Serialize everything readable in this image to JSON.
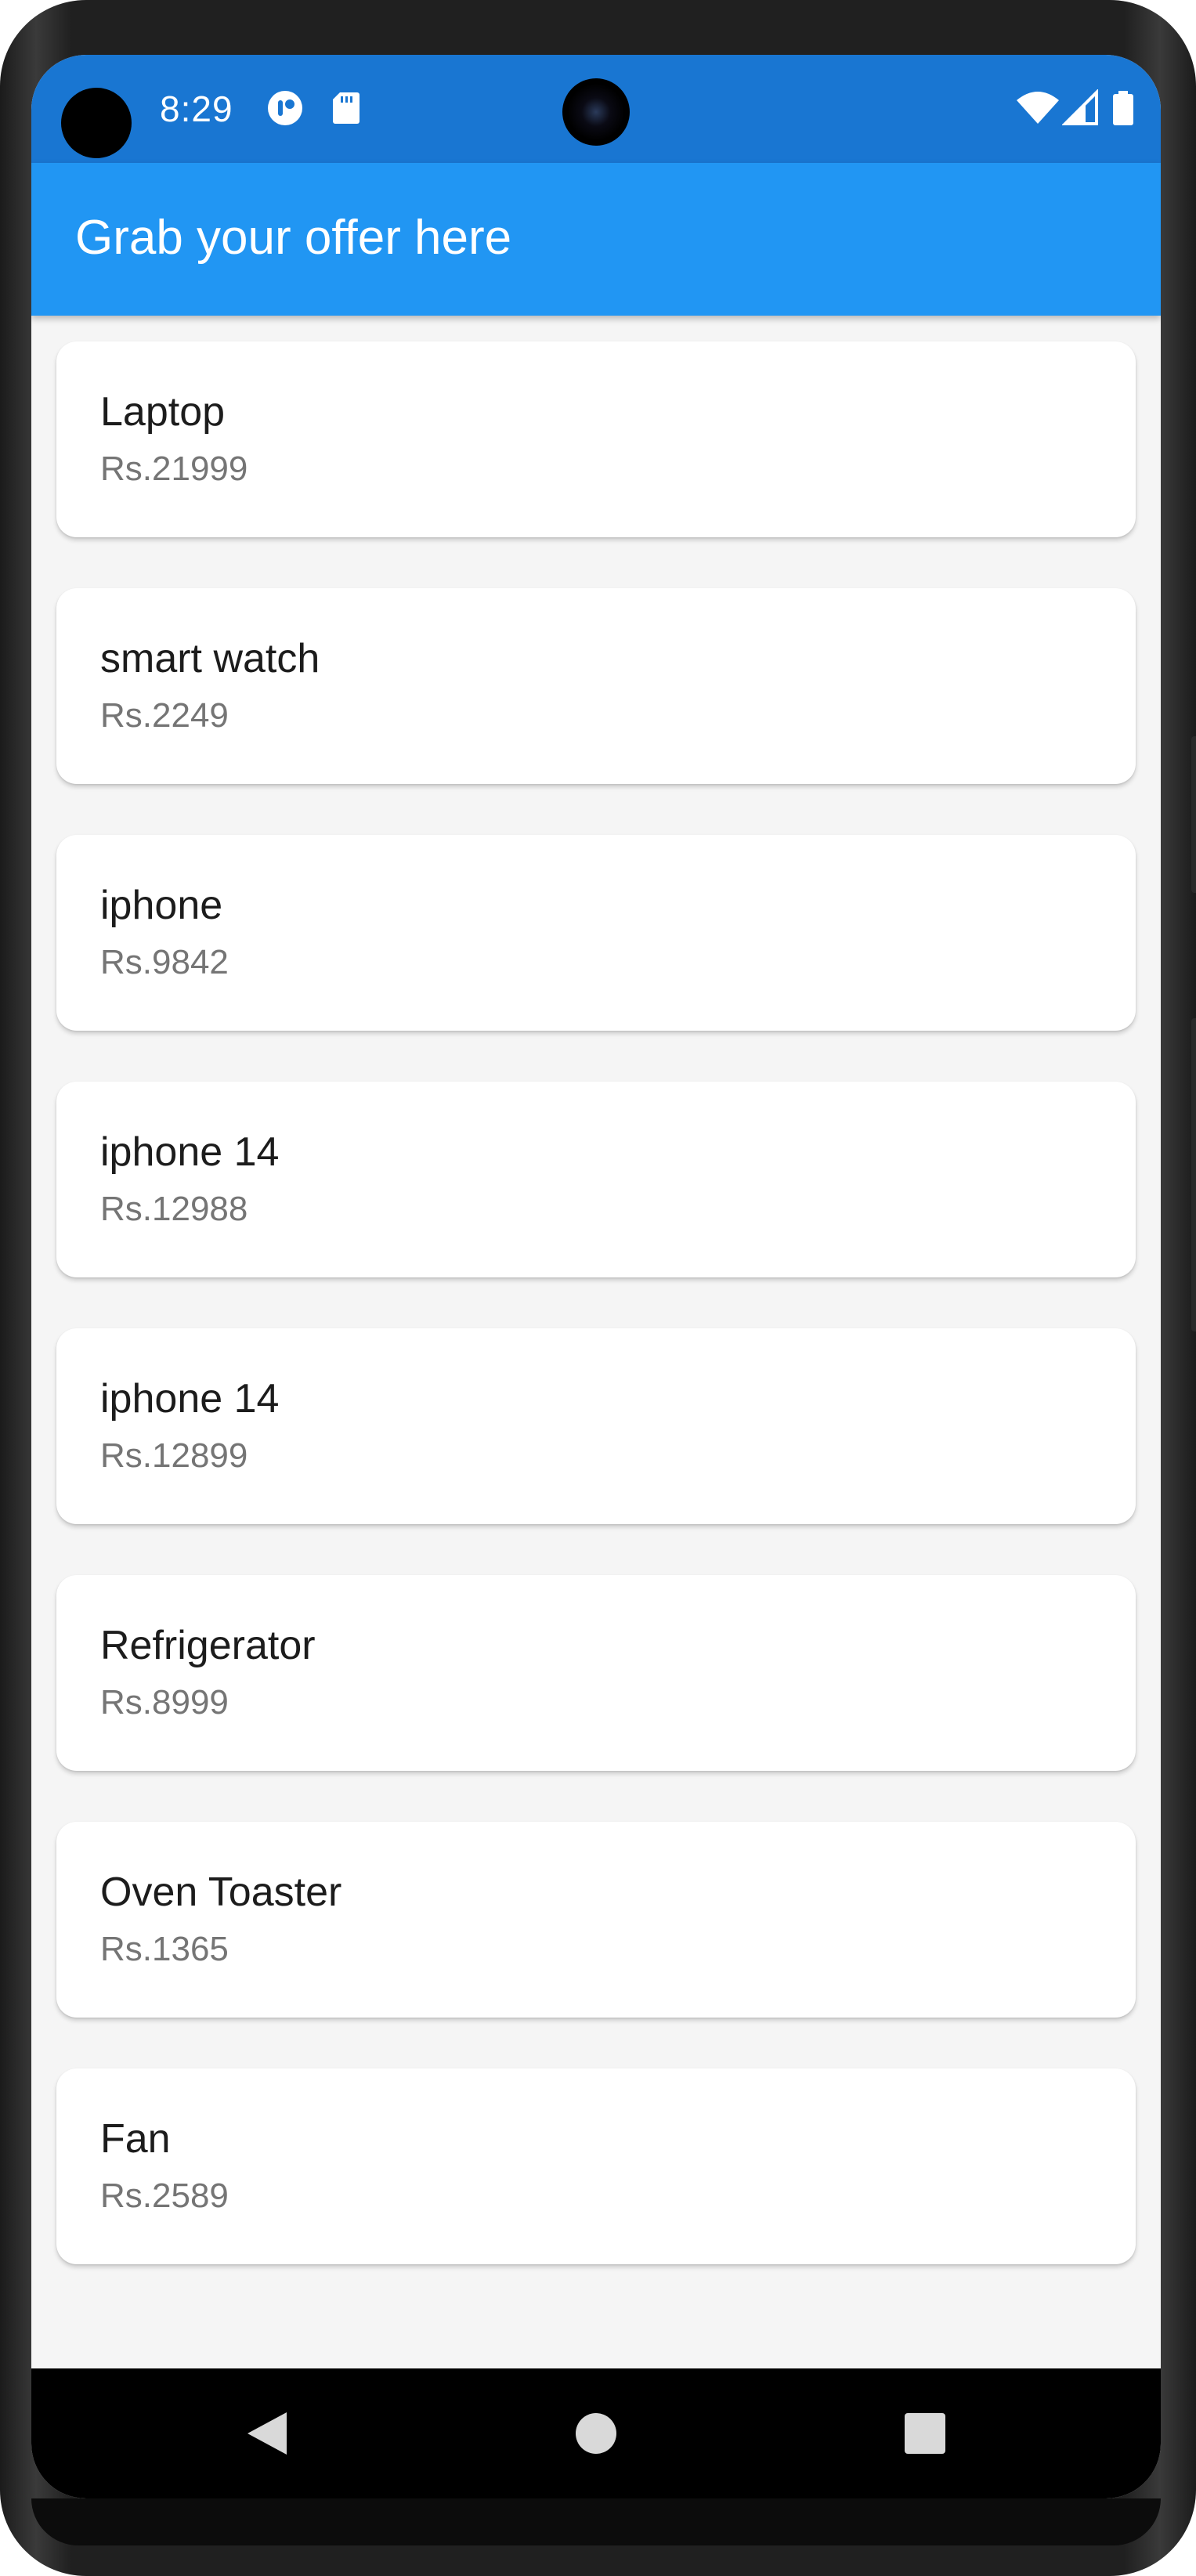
{
  "status_bar": {
    "time": "8:29",
    "icons": [
      "notification-app-icon",
      "sd-card-icon",
      "wifi-icon",
      "signal-icon",
      "battery-icon"
    ],
    "color": "#1976d2"
  },
  "app_bar": {
    "title": "Grab your offer here",
    "color": "#2196f3"
  },
  "products": [
    {
      "name": "Laptop",
      "price": "Rs.21999"
    },
    {
      "name": "smart watch",
      "price": "Rs.2249"
    },
    {
      "name": "iphone",
      "price": "Rs.9842"
    },
    {
      "name": "iphone 14",
      "price": "Rs.12988"
    },
    {
      "name": "iphone 14",
      "price": "Rs.12899"
    },
    {
      "name": "Refrigerator",
      "price": "Rs.8999"
    },
    {
      "name": "Oven Toaster",
      "price": "Rs.1365"
    },
    {
      "name": "Fan",
      "price": "Rs.2589"
    }
  ],
  "nav_bar": {
    "items": [
      "back-icon",
      "home-icon",
      "recents-icon"
    ]
  }
}
